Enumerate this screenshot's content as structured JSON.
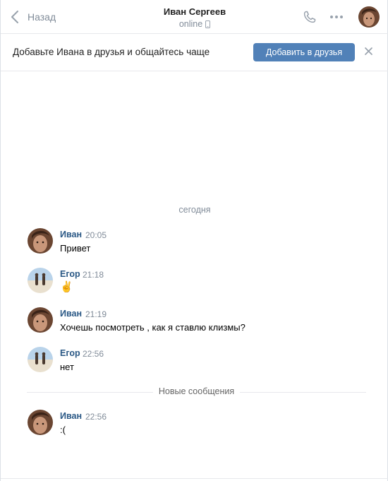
{
  "header": {
    "back_label": "Назад",
    "title": "Иван Сергеев",
    "status": "online"
  },
  "banner": {
    "text": "Добавьте Ивана в друзья и общайтесь чаще",
    "button_label": "Добавить в друзья"
  },
  "chat": {
    "day_separator": "сегодня",
    "new_messages_label": "Новые сообщения",
    "messages": [
      {
        "author": "Иван",
        "time": "20:05",
        "text": "Привет"
      },
      {
        "author": "Егор",
        "time": "21:18",
        "text": "✌️"
      },
      {
        "author": "Иван",
        "time": "21:19",
        "text": "Хочешь посмотреть , как я ставлю клизмы?"
      },
      {
        "author": "Егор",
        "time": "22:56",
        "text": "нет"
      },
      {
        "author": "Иван",
        "time": "22:56",
        "text": ":("
      }
    ]
  },
  "colors": {
    "accent": "#5181b8",
    "author_link": "#2a5885",
    "muted_text": "#818c99",
    "divider": "#e7e8ec"
  },
  "icons": [
    "chevron-left-icon",
    "phone-icon",
    "mobile-icon",
    "more-dots-icon",
    "close-icon"
  ]
}
